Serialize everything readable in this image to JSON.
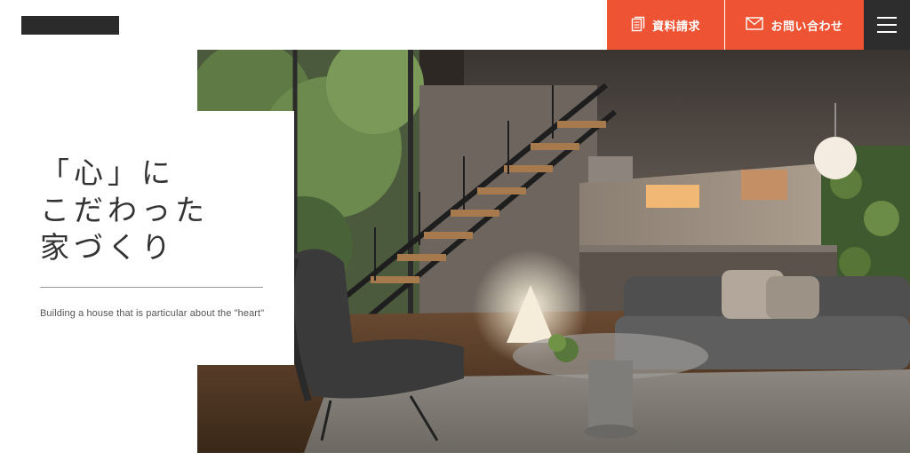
{
  "header": {
    "logo_alt": "logo",
    "docs_button_label": "資料請求",
    "contact_button_label": "お問い合わせ",
    "menu_icon": "hamburger-menu-icon",
    "accent_color": "#ee5434",
    "menu_bg_color": "#2d2d2d"
  },
  "hero": {
    "title_lines": [
      "「心」に",
      "こだわった",
      "家づくり"
    ],
    "subtitle": "Building a house that is particular about the \"heart\"",
    "image_alt": "modern living room interior with open staircase"
  }
}
